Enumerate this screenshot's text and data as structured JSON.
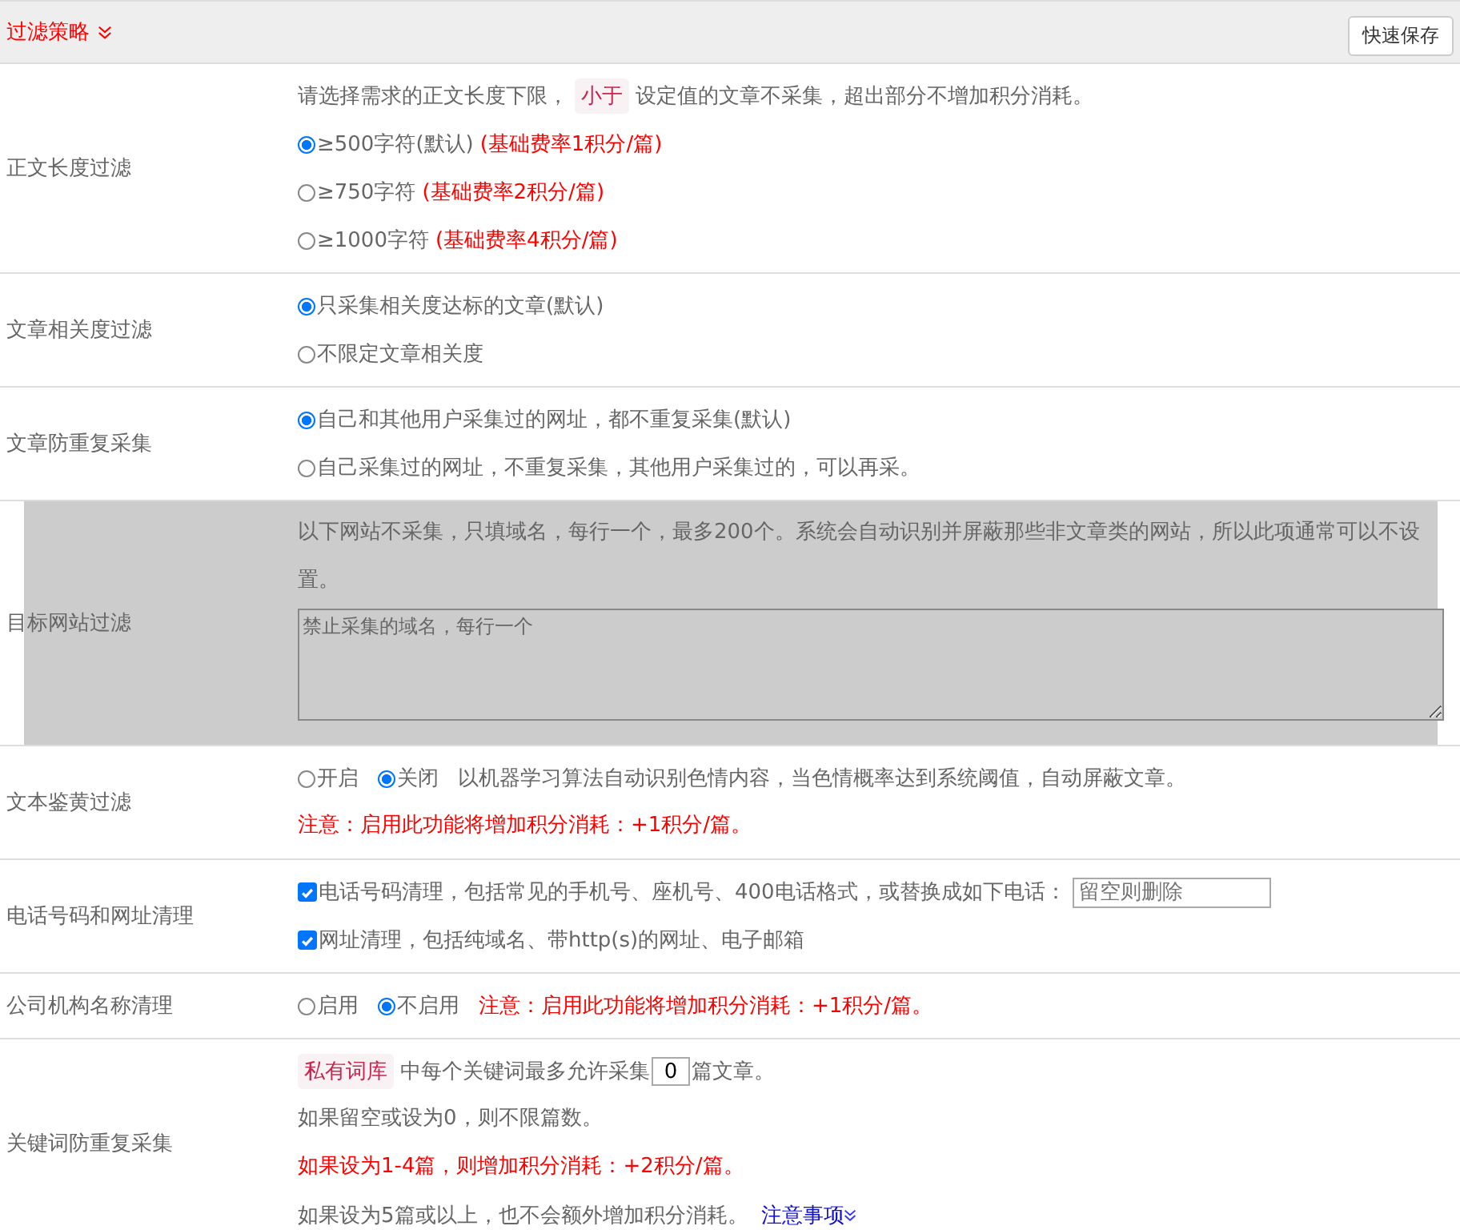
{
  "section": {
    "title": "过滤策略",
    "expanded": true
  },
  "save_button": "快速保存",
  "rows": [
    {
      "label": "正文长度过滤",
      "disabled": false,
      "lines": [
        {
          "kind": "tag_text",
          "before": "请选择需求的正文长度下限，",
          "tag": "小于",
          "after": "设定值的文章不采集，超出部分不增加积分消耗。"
        },
        {
          "kind": "radio",
          "text": "≥500字符(默认)",
          "note": "(基础费率1积分/篇)",
          "selected": true
        },
        {
          "kind": "radio",
          "text": "≥750字符",
          "note": "(基础费率2积分/篇)",
          "selected": false
        },
        {
          "kind": "radio",
          "text": "≥1000字符",
          "note": "(基础费率4积分/篇)",
          "selected": false
        }
      ]
    },
    {
      "label": "文章相关度过滤",
      "disabled": false,
      "lines": [
        {
          "kind": "radio",
          "text": "只采集相关度达标的文章(默认)",
          "selected": true
        },
        {
          "kind": "radio",
          "text": "不限定文章相关度",
          "selected": false
        }
      ]
    },
    {
      "label": "文章防重复采集",
      "disabled": false,
      "lines": [
        {
          "kind": "radio",
          "text": "自己和其他用户采集过的网址，都不重复采集(默认)",
          "selected": true
        },
        {
          "kind": "radio",
          "text": "自己采集过的网址，不重复采集，其他用户采集过的，可以再采。",
          "selected": false
        }
      ]
    },
    {
      "label": "目标网站过滤",
      "disabled": true,
      "lines": [
        {
          "kind": "text",
          "text": "以下网站不采集，只填域名，每行一个，最多200个。系统会自动识别并屏蔽那些非文章类的网站，所以此项通常可以不设置。",
          "warning": false
        },
        {
          "kind": "textarea",
          "placeholder": "禁止采集的域名，每行一个"
        }
      ]
    },
    {
      "label": "文本鉴黄过滤",
      "disabled": false,
      "lines": [
        {
          "kind": "radio_inline",
          "options": [
            {
              "text": "开启",
              "selected": false
            },
            {
              "text": "关闭",
              "selected": true
            }
          ],
          "after": "以机器学习算法自动识别色情内容，当色情概率达到系统阈值，自动屏蔽文章。",
          "warning": false
        },
        {
          "kind": "text",
          "text": "注意：启用此功能将增加积分消耗：+1积分/篇。",
          "warning": true
        }
      ]
    },
    {
      "label": "电话号码和网址清理",
      "disabled": false,
      "lines": [
        {
          "kind": "checkbox",
          "text": "电话号码清理，包括常见的手机号、座机号、400电话格式，或替换成如下电话：",
          "checked": true,
          "field": {
            "placeholder": "留空则删除"
          }
        },
        {
          "kind": "checkbox",
          "text": "网址清理，包括纯域名、带http(s)的网址、电子邮箱",
          "checked": true
        }
      ]
    },
    {
      "label": "公司机构名称清理",
      "disabled": false,
      "lines": [
        {
          "kind": "radio_inline",
          "options": [
            {
              "text": "启用",
              "selected": false
            },
            {
              "text": "不启用",
              "selected": true
            }
          ],
          "after": "注意：启用此功能将增加积分消耗：+1积分/篇。",
          "warning": true
        }
      ]
    },
    {
      "label": "关键词防重复采集",
      "disabled": false,
      "lines": [
        {
          "kind": "tag_input",
          "tag": "私有词库",
          "before": "中每个关键词最多允许采集",
          "value": "0",
          "after": "篇文章。"
        },
        {
          "kind": "text",
          "text": "如果留空或设为0，则不限篇数。",
          "warning": false
        },
        {
          "kind": "text",
          "text": "如果设为1-4篇，则增加积分消耗：+2积分/篇。",
          "warning": true
        },
        {
          "kind": "text_link",
          "text": "如果设为5篇或以上，也不会额外增加积分消耗。",
          "link": "注意事项"
        }
      ]
    }
  ]
}
